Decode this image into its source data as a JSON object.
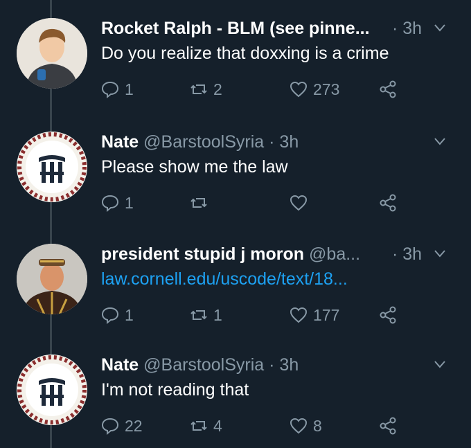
{
  "colors": {
    "background": "#15202b",
    "muted": "#8899a6",
    "link": "#1da1f2",
    "thread_line": "#38444d"
  },
  "tweets": [
    {
      "avatar_icon": "cartoon-man-avatar",
      "name": "Rocket Ralph - BLM (see pinne...",
      "handle": "",
      "time": "· 3h",
      "text": "Do you realize that doxxing is a crime",
      "is_link": false,
      "replies": "1",
      "retweets": "2",
      "likes": "273"
    },
    {
      "avatar_icon": "barstool-logo-avatar",
      "name": "Nate",
      "handle": "@BarstoolSyria",
      "time": "· 3h",
      "text": "Please show me the law",
      "is_link": false,
      "replies": "1",
      "retweets": "",
      "likes": ""
    },
    {
      "avatar_icon": "man-photo-avatar",
      "name": "president stupid j moron",
      "handle": "@ba...",
      "time": "· 3h",
      "text": "law.cornell.edu/uscode/text/18...",
      "is_link": true,
      "replies": "1",
      "retweets": "1",
      "likes": "177"
    },
    {
      "avatar_icon": "barstool-logo-avatar",
      "name": "Nate",
      "handle": "@BarstoolSyria",
      "time": "· 3h",
      "text": "I'm not reading that",
      "is_link": false,
      "replies": "22",
      "retweets": "4",
      "likes": "8"
    }
  ]
}
